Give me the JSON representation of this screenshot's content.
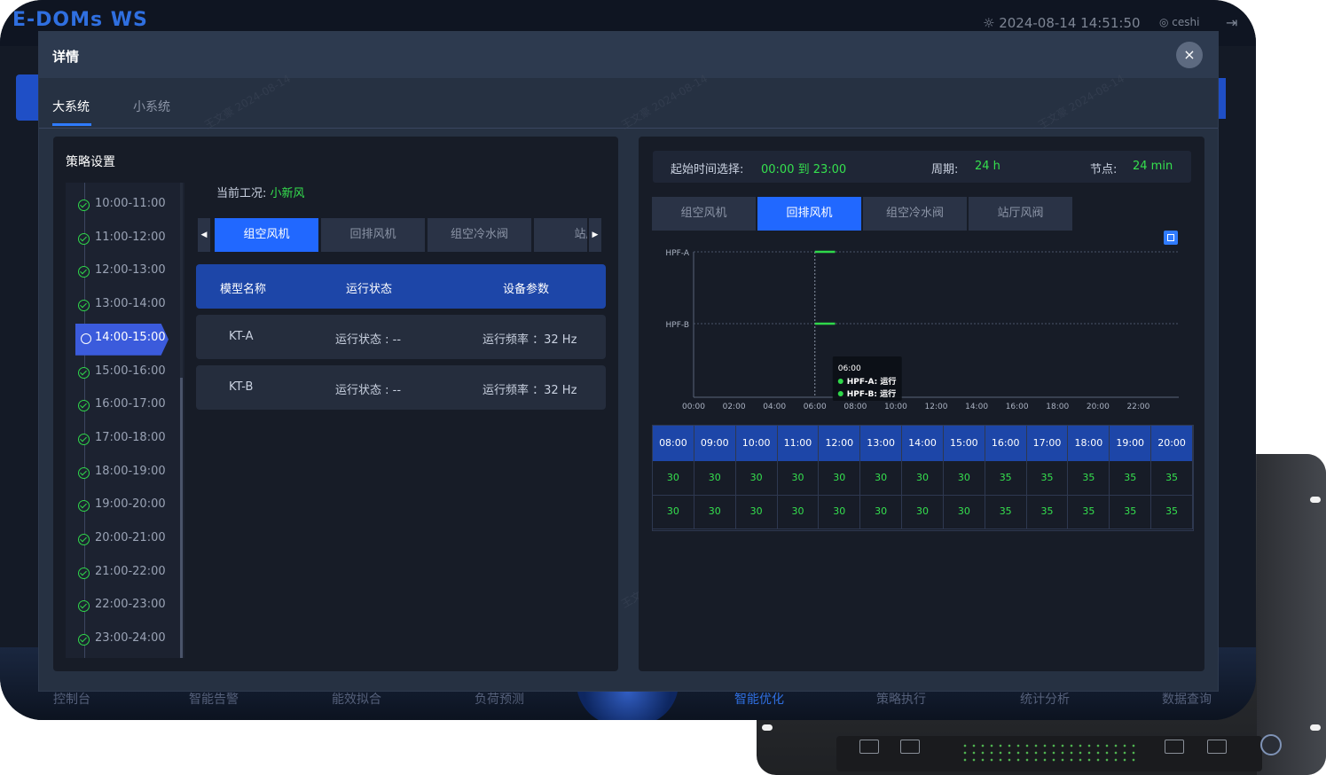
{
  "app": {
    "logo": "E-DOMs WS",
    "datetime": "2024-08-14 14:51:50",
    "user": "ceshi"
  },
  "bottom_nav": [
    "控制台",
    "智能告警",
    "能效拟合",
    "负荷预测",
    "智能优化",
    "策略执行",
    "统计分析",
    "数据查询"
  ],
  "bottom_nav_active": 4,
  "modal": {
    "title": "详情",
    "close_label": "×",
    "tabs": [
      "大系统",
      "小系统"
    ],
    "active_tab": 0
  },
  "strategy": {
    "title": "策略设置",
    "time_slots": [
      "10:00-11:00",
      "11:00-12:00",
      "12:00-13:00",
      "13:00-14:00",
      "14:00-15:00",
      "15:00-16:00",
      "16:00-17:00",
      "17:00-18:00",
      "18:00-19:00",
      "19:00-20:00",
      "20:00-21:00",
      "21:00-22:00",
      "22:00-23:00",
      "23:00-24:00"
    ],
    "active_slot": 4,
    "condition_label": "当前工况:",
    "condition_value": "小新风",
    "device_tabs": [
      "组空风机",
      "回排风机",
      "组空冷水阀",
      "站厅"
    ],
    "active_device_tab": 0,
    "table_headers": [
      "模型名称",
      "运行状态",
      "设备参数"
    ],
    "rows": [
      {
        "name": "KT-A",
        "status": "运行状态 : --",
        "param": "运行频率 ：32 Hz"
      },
      {
        "name": "KT-B",
        "status": "运行状态 : --",
        "param": "运行频率 ：32 Hz"
      }
    ]
  },
  "schedule": {
    "start_label": "起始时间选择:",
    "start_value": "00:00 到 23:00",
    "period_label": "周期:",
    "period_value": "24 h",
    "node_label": "节点:",
    "node_value": "24 min",
    "tabs": [
      "组空风机",
      "回排风机",
      "组空冷水阀",
      "站厅风阀"
    ],
    "active_tab": 1,
    "grid_headers": [
      "08:00",
      "09:00",
      "10:00",
      "11:00",
      "12:00",
      "13:00",
      "14:00",
      "15:00",
      "16:00",
      "17:00",
      "18:00",
      "19:00",
      "20:00"
    ],
    "grid_rows": [
      [
        "30",
        "30",
        "30",
        "30",
        "30",
        "30",
        "30",
        "30",
        "35",
        "35",
        "35",
        "35",
        "35"
      ],
      [
        "30",
        "30",
        "30",
        "30",
        "30",
        "30",
        "30",
        "30",
        "35",
        "35",
        "35",
        "35",
        "35"
      ]
    ]
  },
  "chart_data": {
    "type": "line",
    "x": [
      "00:00",
      "02:00",
      "04:00",
      "06:00",
      "08:00",
      "10:00",
      "12:00",
      "14:00",
      "16:00",
      "18:00",
      "20:00",
      "22:00"
    ],
    "y_categories": [
      "HPF-A",
      "HPF-B"
    ],
    "series": [
      {
        "name": "HPF-A",
        "segments": [
          [
            "06:00",
            "07:00"
          ]
        ],
        "color": "#2fd84a"
      },
      {
        "name": "HPF-B",
        "segments": [
          [
            "06:00",
            "07:00"
          ]
        ],
        "color": "#2fd84a"
      }
    ],
    "tooltip": {
      "time": "06:00",
      "lines": [
        "HPF-A: 运行",
        "HPF-B: 运行"
      ]
    },
    "grid": true
  },
  "watermark": {
    "line1": "王文豪",
    "line2": "2024-08-14"
  }
}
